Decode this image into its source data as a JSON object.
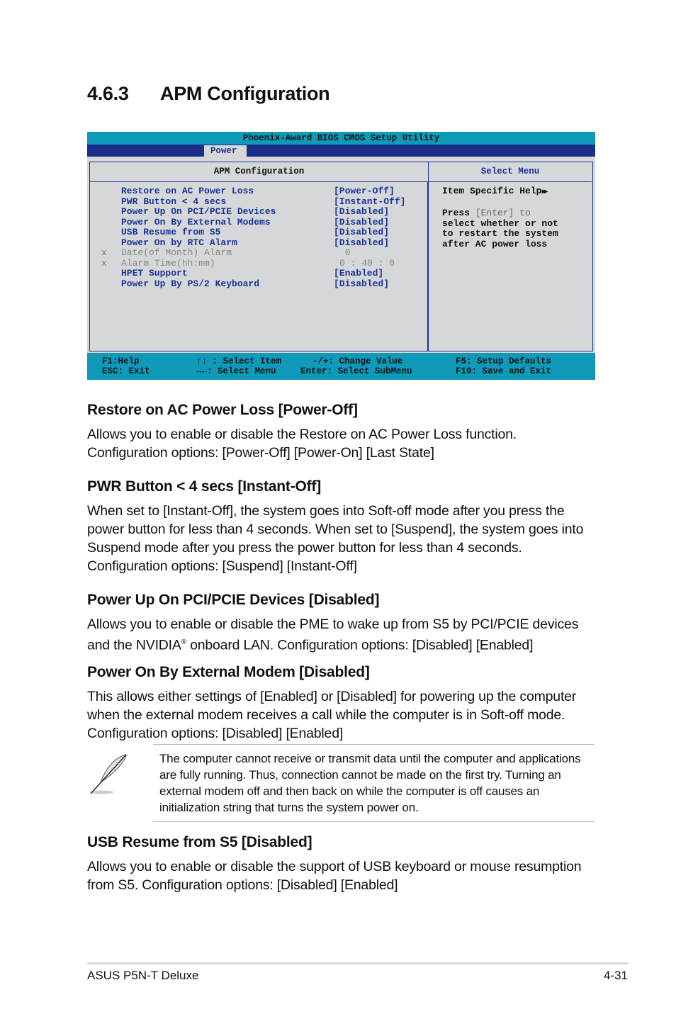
{
  "section": {
    "number": "4.6.3",
    "title": "APM Configuration"
  },
  "bios": {
    "title": "Phoenix-Award BIOS CMOS Setup Utility",
    "active_tab": "Power",
    "left_header": "APM Configuration",
    "right_header": "Select Menu",
    "items": [
      {
        "x": "",
        "label": "Restore on AC Power Loss",
        "value": "[Power-Off]",
        "enabled": true
      },
      {
        "x": "",
        "label": "PWR Button < 4 secs",
        "value": "[Instant-Off]",
        "enabled": true
      },
      {
        "x": "",
        "label": "Power Up On PCI/PCIE Devices",
        "value": "[Disabled]",
        "enabled": true
      },
      {
        "x": "",
        "label": "Power On By External Modems",
        "value": "[Disabled]",
        "enabled": true
      },
      {
        "x": "",
        "label": "USB Resume from S5",
        "value": "[Disabled]",
        "enabled": true
      },
      {
        "x": "",
        "label": "Power On by RTC Alarm",
        "value": "[Disabled]",
        "enabled": true
      },
      {
        "x": "x",
        "label": "Date(of Month) Alarm",
        "value": " 0",
        "enabled": false
      },
      {
        "x": "x",
        "label": "Alarm Time(hh:mm)",
        "value": "0 : 40 : 0",
        "enabled": false
      },
      {
        "x": "",
        "label": "HPET Support",
        "value": "[Enabled]",
        "enabled": true
      },
      {
        "x": "",
        "label": "Power Up By PS/2 Keyboard",
        "value": "[Disabled]",
        "enabled": true
      }
    ],
    "help": {
      "title": "Item Specific Help",
      "title_icon": "double-arrow-right",
      "line1_a": "Press ",
      "line1_b": "[Enter]",
      "line1_c": " to",
      "line2": "select whether or not",
      "line3": "to restart the system",
      "line4": "after AC power loss"
    },
    "footer": {
      "f1": "F1:Help",
      "esc": "ESC: Exit",
      "updown": "↑↓ : Select Item",
      "leftright": "→←: Select Menu",
      "change": "-/+: Change Value",
      "enter": "Enter: Select SubMenu",
      "f5": "F5: Setup Defaults",
      "f10": "F10: Save and Exit"
    }
  },
  "sections": [
    {
      "heading": "Restore on AC Power Loss [Power-Off]",
      "body": "Allows you to enable or disable the Restore on AC Power Loss function. Configuration options: [Power-Off] [Power-On] [Last State]"
    },
    {
      "heading": "PWR Button < 4 secs [Instant-Off]",
      "body": "When set to [Instant-Off], the system goes into Soft-off mode after you press the power button for less than 4 seconds. When set to [Suspend], the system goes into Suspend mode after you press the power button for less than 4 seconds. Configuration options: [Suspend] [Instant-Off]"
    },
    {
      "heading": "Power Up On PCI/PCIE Devices [Disabled]",
      "body_a": "Allows you to enable or disable the PME to wake up from S5 by PCI/PCIE devices and the NVIDIA",
      "body_sup": "®",
      "body_b": " onboard LAN. Configuration options: [Disabled] [Enabled]"
    },
    {
      "heading": "Power On By External Modem [Disabled]",
      "body": "This allows either settings of [Enabled] or [Disabled] for powering up the computer when the external modem receives a call while the computer is in Soft-off mode. Configuration options: [Disabled] [Enabled]"
    },
    {
      "heading": "USB Resume from S5 [Disabled]",
      "body": "Allows you to enable or disable the support of USB keyboard or mouse resumption from S5. Configuration options: [Disabled] [Enabled]"
    }
  ],
  "note": {
    "icon": "feather-quill-icon",
    "text": "The computer cannot receive or transmit data until the computer and applications are fully running. Thus, connection cannot be made on the first try. Turning an external modem off and then back on while the computer is off causes an initialization string that turns the system power on."
  },
  "footer": {
    "product": "ASUS P5N-T Deluxe",
    "page": "4-31"
  }
}
